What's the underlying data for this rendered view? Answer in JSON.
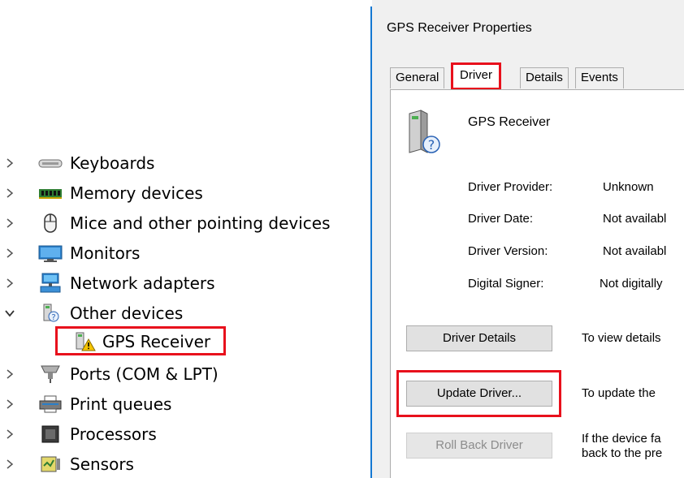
{
  "tree": {
    "items": [
      {
        "label": "Keyboards",
        "icon": "keyboard-icon",
        "expanded": false
      },
      {
        "label": "Memory devices",
        "icon": "memory-icon",
        "expanded": false
      },
      {
        "label": "Mice and other pointing devices",
        "icon": "mouse-icon",
        "expanded": false
      },
      {
        "label": "Monitors",
        "icon": "monitor-icon",
        "expanded": false
      },
      {
        "label": "Network adapters",
        "icon": "network-icon",
        "expanded": false
      },
      {
        "label": "Other devices",
        "icon": "unknown-device-icon",
        "expanded": true
      },
      {
        "label": "Ports (COM & LPT)",
        "icon": "port-icon",
        "expanded": false
      },
      {
        "label": "Print queues",
        "icon": "printer-icon",
        "expanded": false
      },
      {
        "label": "Processors",
        "icon": "processor-icon",
        "expanded": false
      },
      {
        "label": "Sensors",
        "icon": "sensor-icon",
        "expanded": false
      }
    ],
    "child": {
      "label": "GPS Receiver",
      "icon": "warning-device-icon"
    }
  },
  "dialog": {
    "title": "GPS Receiver Properties",
    "tabs": [
      "General",
      "Driver",
      "Details",
      "Events"
    ],
    "active_tab": "Driver",
    "device_name": "GPS Receiver",
    "properties": [
      {
        "label": "Driver Provider:",
        "value": "Unknown"
      },
      {
        "label": "Driver Date:",
        "value": "Not availabl"
      },
      {
        "label": "Driver Version:",
        "value": "Not availabl"
      },
      {
        "label": "Digital Signer:",
        "value": "Not digitally"
      }
    ],
    "buttons": [
      {
        "label": "Driver Details",
        "desc": "To view details",
        "enabled": true
      },
      {
        "label": "Update Driver...",
        "desc": "To update the",
        "enabled": true
      },
      {
        "label": "Roll Back Driver",
        "desc": "If the device fa",
        "desc2": "back to the pre",
        "enabled": false
      }
    ]
  },
  "colors": {
    "highlight": "#e8101c",
    "divider": "#1478d2"
  }
}
